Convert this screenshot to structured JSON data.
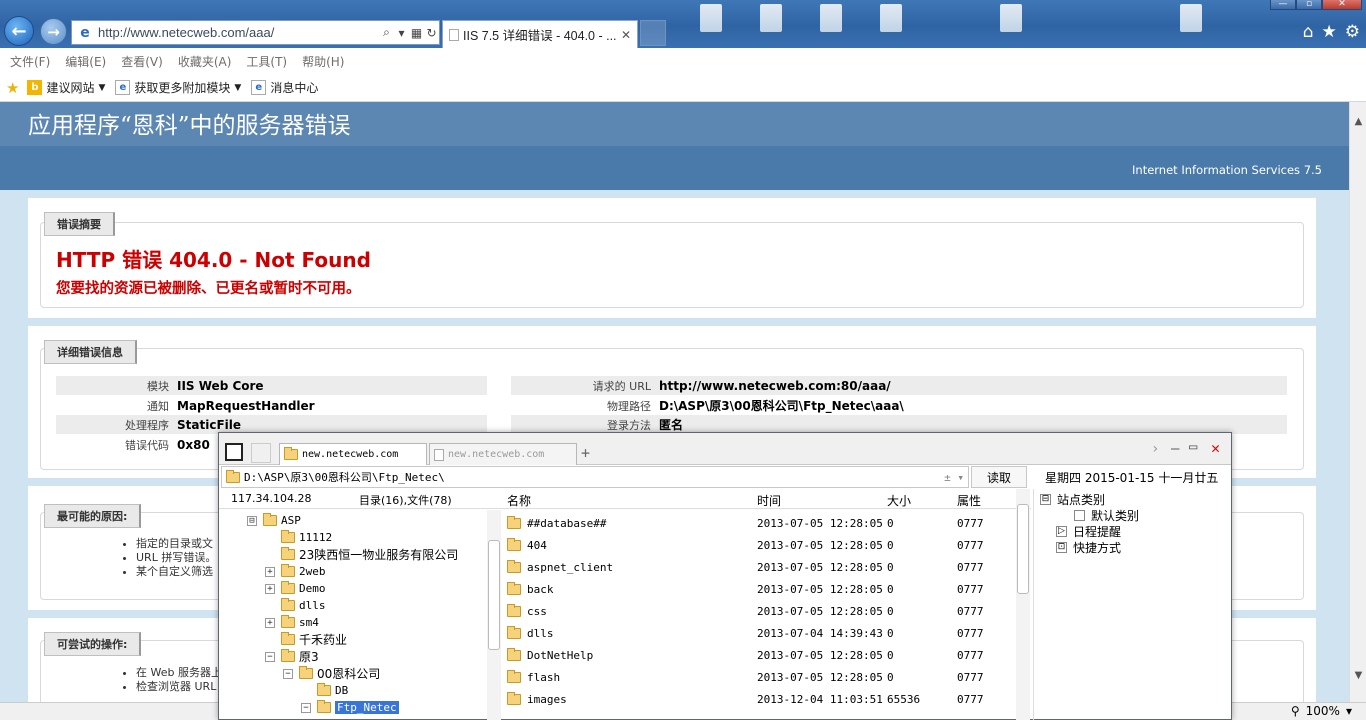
{
  "browser": {
    "address_url": "http://www.netecweb.com/aaa/",
    "tab_title": "IIS 7.5 详细错误 - 404.0 - ...",
    "menu": [
      "文件(F)",
      "编辑(E)",
      "查看(V)",
      "收藏夹(A)",
      "工具(T)",
      "帮助(H)"
    ],
    "favorites": [
      {
        "label": "建议网站",
        "icon": "bing-icon"
      },
      {
        "label": "获取更多附加模块",
        "icon": "ie-page-icon"
      },
      {
        "label": "消息中心",
        "icon": "ie-page-icon"
      }
    ],
    "zoom": "100%"
  },
  "iis": {
    "title": "应用程序“恩科”中的服务器错误",
    "version": "Internet Information Services 7.5",
    "summary_legend": "错误摘要",
    "error_title": "HTTP 错误 404.0 - Not Found",
    "error_desc": "您要找的资源已被删除、已更名或暂时不可用。",
    "detail_legend": "详细错误信息",
    "details_left": [
      {
        "label": "模块",
        "value": "IIS Web Core"
      },
      {
        "label": "通知",
        "value": "MapRequestHandler"
      },
      {
        "label": "处理程序",
        "value": "StaticFile"
      },
      {
        "label": "错误代码",
        "value": "0x80"
      }
    ],
    "details_right": [
      {
        "label": "请求的 URL",
        "value": "http://www.netecweb.com:80/aaa/"
      },
      {
        "label": "物理路径",
        "value": "D:\\ASP\\原3\\00恩科公司\\Ftp_Netec\\aaa\\"
      },
      {
        "label": "登录方法",
        "value": "匿名"
      }
    ],
    "causes_legend": "最可能的原因:",
    "causes": [
      "指定的目录或文",
      "URL 拼写错误。",
      "某个自定义筛选"
    ],
    "actions_legend": "可尝试的操作:",
    "actions": [
      "在 Web 服务器上",
      "检查浏览器 URL"
    ]
  },
  "ftp": {
    "tab_active": "new.netecweb.com",
    "tab_inactive": "new.netecweb.com",
    "path": "D:\\ASP\\原3\\00恩科公司\\Ftp_Netec\\",
    "read_label": "读取",
    "date": "星期四 2015-01-15 十一月廿五",
    "ip": "117.34.104.28",
    "dir_summary": "目录(16),文件(78)",
    "columns": {
      "name": "名称",
      "time": "时间",
      "size": "大小",
      "attr": "属性"
    },
    "tree": [
      {
        "name": "ASP",
        "expander": "⊟",
        "indent": 0
      },
      {
        "name": "11112",
        "expander": "",
        "indent": 1
      },
      {
        "name": "23陕西恒一物业服务有限公司",
        "expander": "",
        "indent": 1
      },
      {
        "name": "2web",
        "expander": "+",
        "indent": 1
      },
      {
        "name": "Demo",
        "expander": "+",
        "indent": 1
      },
      {
        "name": "dlls",
        "expander": "",
        "indent": 1
      },
      {
        "name": "sm4",
        "expander": "+",
        "indent": 1
      },
      {
        "name": "千禾药业",
        "expander": "",
        "indent": 1
      },
      {
        "name": "原3",
        "expander": "−",
        "indent": 1
      },
      {
        "name": "00恩科公司",
        "expander": "−",
        "indent": 2
      },
      {
        "name": "DB",
        "expander": "",
        "indent": 3
      },
      {
        "name": "Ftp_Netec",
        "expander": "−",
        "indent": 3,
        "selected": true
      }
    ],
    "files": [
      {
        "name": "##database##",
        "time": "2013-07-05 12:28:05",
        "size": "0",
        "attr": "0777"
      },
      {
        "name": "404",
        "time": "2013-07-05 12:28:05",
        "size": "0",
        "attr": "0777"
      },
      {
        "name": "aspnet_client",
        "time": "2013-07-05 12:28:05",
        "size": "0",
        "attr": "0777"
      },
      {
        "name": "back",
        "time": "2013-07-05 12:28:05",
        "size": "0",
        "attr": "0777"
      },
      {
        "name": "css",
        "time": "2013-07-05 12:28:05",
        "size": "0",
        "attr": "0777"
      },
      {
        "name": "dlls",
        "time": "2013-07-04 14:39:43",
        "size": "0",
        "attr": "0777"
      },
      {
        "name": "DotNetHelp",
        "time": "2013-07-05 12:28:05",
        "size": "0",
        "attr": "0777"
      },
      {
        "name": "flash",
        "time": "2013-07-05 12:28:05",
        "size": "0",
        "attr": "0777"
      },
      {
        "name": "images",
        "time": "2013-12-04 11:03:51",
        "size": "65536",
        "attr": "0777"
      }
    ],
    "side_tree": [
      {
        "label": "站点类别",
        "box": "⊟"
      },
      {
        "label": "默认类别",
        "box": ""
      },
      {
        "label": "日程提醒",
        "box": "▷"
      },
      {
        "label": "快捷方式",
        "box": "⊡"
      }
    ]
  }
}
